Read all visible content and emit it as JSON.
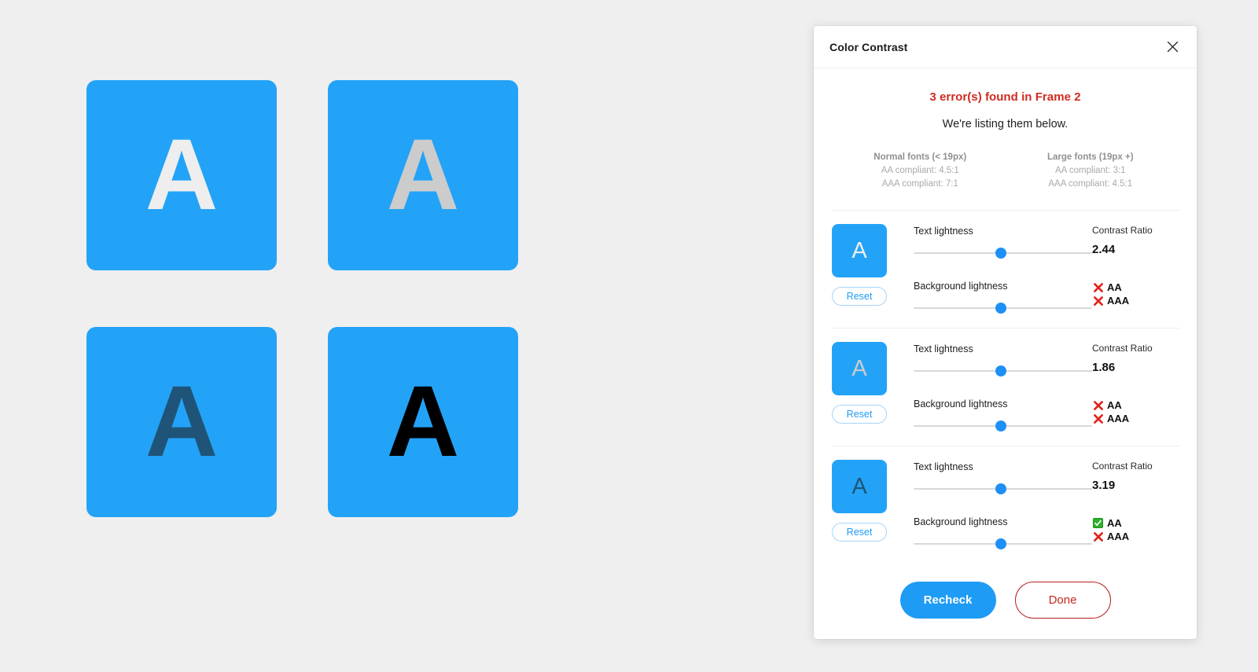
{
  "canvas": {
    "background": "#efefef",
    "swatches": [
      {
        "letter": "A",
        "bg": "#23a3f7",
        "fg": "#eeeeee",
        "name": "swatch-white-a"
      },
      {
        "letter": "A",
        "bg": "#23a3f7",
        "fg": "#cccccc",
        "name": "swatch-gray-a"
      },
      {
        "letter": "A",
        "bg": "#23a3f7",
        "fg": "#1f5478",
        "name": "swatch-darkblue-a"
      },
      {
        "letter": "A",
        "bg": "#23a3f7",
        "fg": "#000000",
        "name": "swatch-black-a"
      }
    ]
  },
  "panel": {
    "title": "Color Contrast",
    "close_icon": "close-icon",
    "error_heading": "3 error(s) found in Frame 2",
    "error_sub": "We're listing them below.",
    "error_color": "#d02b20",
    "accent_color": "#1e9bf5",
    "danger_color": "#b22118",
    "compliance": [
      {
        "title": "Normal fonts (< 19px)",
        "aa": "AA compliant: 4.5:1",
        "aaa": "AAA compliant: 7:1"
      },
      {
        "title": "Large fonts (19px +)",
        "aa": "AA compliant: 3:1",
        "aaa": "AAA compliant: 4.5:1"
      }
    ],
    "labels": {
      "text_lightness": "Text lightness",
      "background_lightness": "Background lightness",
      "contrast_ratio": "Contrast Ratio",
      "reset": "Reset",
      "aa": "AA",
      "aaa": "AAA"
    },
    "results": [
      {
        "preview_letter": "A",
        "preview_bg": "#23a3f7",
        "preview_fg": "#eeeeee",
        "text_lightness_pct": 49,
        "background_lightness_pct": 49,
        "contrast_ratio": "2.44",
        "aa_pass": false,
        "aaa_pass": false
      },
      {
        "preview_letter": "A",
        "preview_bg": "#23a3f7",
        "preview_fg": "#cccccc",
        "text_lightness_pct": 49,
        "background_lightness_pct": 49,
        "contrast_ratio": "1.86",
        "aa_pass": false,
        "aaa_pass": false
      },
      {
        "preview_letter": "A",
        "preview_bg": "#23a3f7",
        "preview_fg": "#1f5478",
        "text_lightness_pct": 49,
        "background_lightness_pct": 49,
        "contrast_ratio": "3.19",
        "aa_pass": true,
        "aaa_pass": false
      }
    ],
    "footer": {
      "recheck_label": "Recheck",
      "done_label": "Done"
    }
  }
}
